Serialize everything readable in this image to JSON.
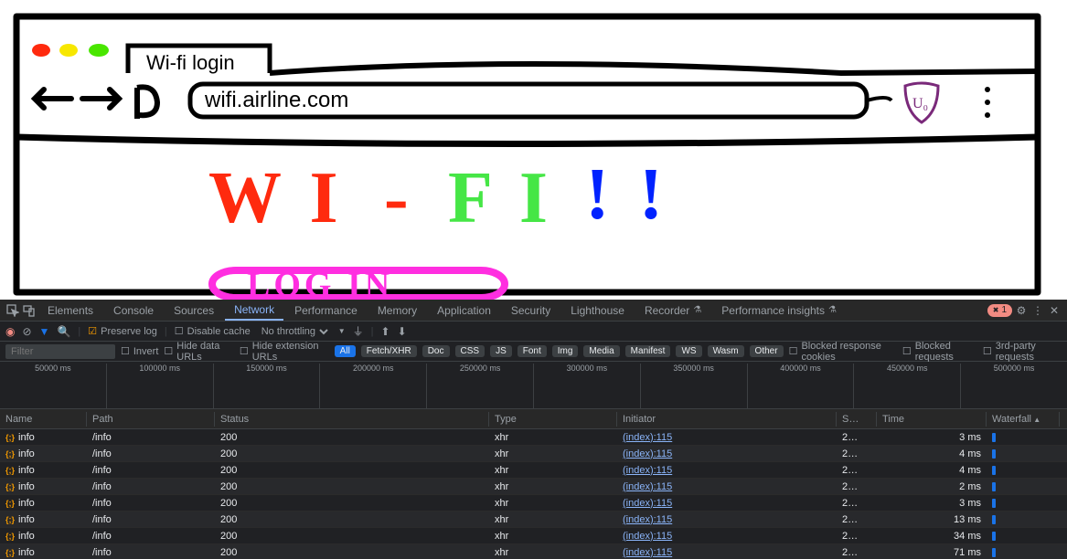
{
  "browser": {
    "tab_title": "Wi-fi login",
    "url": "wifi.airline.com"
  },
  "page": {
    "heading_wi": "W I",
    "heading_dash": "-",
    "heading_fi": "F I",
    "heading_bang": "! !",
    "login_button": "LOG IN"
  },
  "devtools": {
    "tabs": [
      "Elements",
      "Console",
      "Sources",
      "Network",
      "Performance",
      "Memory",
      "Application",
      "Security",
      "Lighthouse",
      "Recorder",
      "Performance insights"
    ],
    "active_tab": "Network",
    "error_count": "1",
    "controls": {
      "preserve_log": "Preserve log",
      "disable_cache": "Disable cache",
      "throttling": "No throttling"
    },
    "filter": {
      "placeholder": "Filter",
      "invert": "Invert",
      "hide_data_urls": "Hide data URLs",
      "hide_ext_urls": "Hide extension URLs",
      "types": [
        "All",
        "Fetch/XHR",
        "Doc",
        "CSS",
        "JS",
        "Font",
        "Img",
        "Media",
        "Manifest",
        "WS",
        "Wasm",
        "Other"
      ],
      "active_type": "All",
      "blocked_cookies": "Blocked response cookies",
      "blocked_requests": "Blocked requests",
      "third_party": "3rd-party requests"
    },
    "timeline": [
      "50000 ms",
      "100000 ms",
      "150000 ms",
      "200000 ms",
      "250000 ms",
      "300000 ms",
      "350000 ms",
      "400000 ms",
      "450000 ms",
      "500000 ms"
    ],
    "columns": [
      "Name",
      "Path",
      "Status",
      "Type",
      "Initiator",
      "S…",
      "Time",
      "Waterfall"
    ],
    "rows": [
      {
        "name": "info",
        "path": "/info",
        "status": "200",
        "type": "xhr",
        "initiator": "(index):115",
        "size": "2…",
        "time": "3 ms"
      },
      {
        "name": "info",
        "path": "/info",
        "status": "200",
        "type": "xhr",
        "initiator": "(index):115",
        "size": "2…",
        "time": "4 ms"
      },
      {
        "name": "info",
        "path": "/info",
        "status": "200",
        "type": "xhr",
        "initiator": "(index):115",
        "size": "2…",
        "time": "4 ms"
      },
      {
        "name": "info",
        "path": "/info",
        "status": "200",
        "type": "xhr",
        "initiator": "(index):115",
        "size": "2…",
        "time": "2 ms"
      },
      {
        "name": "info",
        "path": "/info",
        "status": "200",
        "type": "xhr",
        "initiator": "(index):115",
        "size": "2…",
        "time": "3 ms"
      },
      {
        "name": "info",
        "path": "/info",
        "status": "200",
        "type": "xhr",
        "initiator": "(index):115",
        "size": "2…",
        "time": "13 ms"
      },
      {
        "name": "info",
        "path": "/info",
        "status": "200",
        "type": "xhr",
        "initiator": "(index):115",
        "size": "2…",
        "time": "34 ms"
      },
      {
        "name": "info",
        "path": "/info",
        "status": "200",
        "type": "xhr",
        "initiator": "(index):115",
        "size": "2…",
        "time": "71 ms"
      }
    ]
  }
}
